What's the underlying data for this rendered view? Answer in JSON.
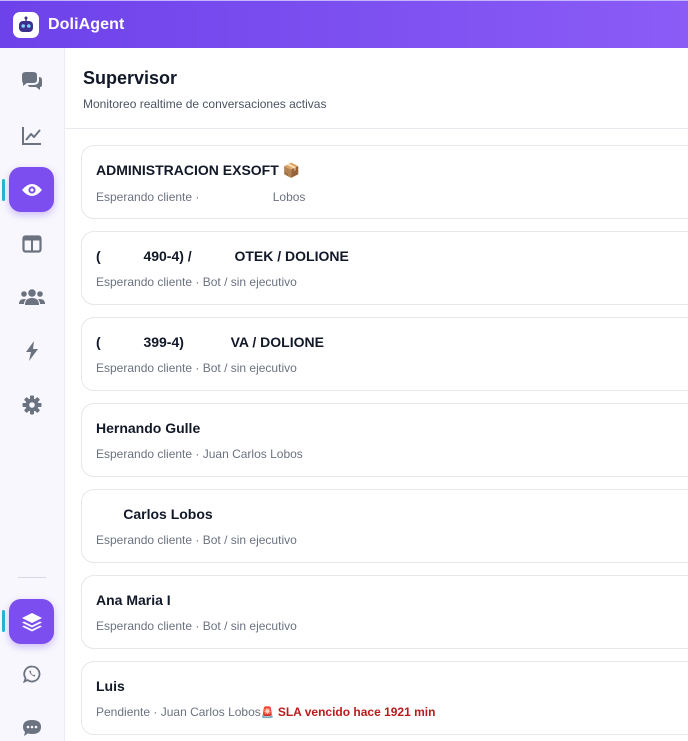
{
  "app": {
    "title": "DoliAgent"
  },
  "sidebar": {
    "items": [
      {
        "icon": "chat-bubbles-icon"
      },
      {
        "icon": "chart-line-icon"
      },
      {
        "icon": "eye-icon",
        "active": true
      },
      {
        "icon": "columns-icon"
      },
      {
        "icon": "users-icon"
      },
      {
        "icon": "bolt-icon"
      },
      {
        "icon": "gear-icon"
      }
    ],
    "bottom_items": [
      {
        "icon": "layers-icon",
        "active": true
      },
      {
        "icon": "whatsapp-icon"
      },
      {
        "icon": "chat-dots-icon"
      }
    ]
  },
  "header": {
    "title": "Supervisor",
    "subtitle": "Monitoreo realtime de conversaciones activas"
  },
  "conversations": [
    {
      "name": "ADMINISTRACION EXSOFT 📦",
      "status": "Esperando cliente · ",
      "agent": "Lobos"
    },
    {
      "name": "(           490-4) /           OTEK / DOLIONE",
      "status": "Esperando cliente · ",
      "agent": "Bot / sin ejecutivo"
    },
    {
      "name": "(           399-4)            VA / DOLIONE",
      "status": "Esperando cliente · ",
      "agent": "Bot / sin ejecutivo"
    },
    {
      "name": "Hernando Gulle",
      "status": "Esperando cliente · ",
      "agent": "Juan Carlos Lobos"
    },
    {
      "name": "       Carlos Lobos",
      "status": "Esperando cliente · ",
      "agent": "Bot / sin ejecutivo"
    },
    {
      "name": "Ana Maria I",
      "status": "Esperando cliente · ",
      "agent": "Bot / sin ejecutivo"
    },
    {
      "name": "Luis",
      "status": "Pendiente · ",
      "agent": "Juan Carlos Lobos",
      "sla": "SLA vencido hace 1921 min"
    }
  ],
  "colors": {
    "accent": "#7c4ef0",
    "active_bar": "#22b8cf",
    "sla": "#b91c1c"
  }
}
